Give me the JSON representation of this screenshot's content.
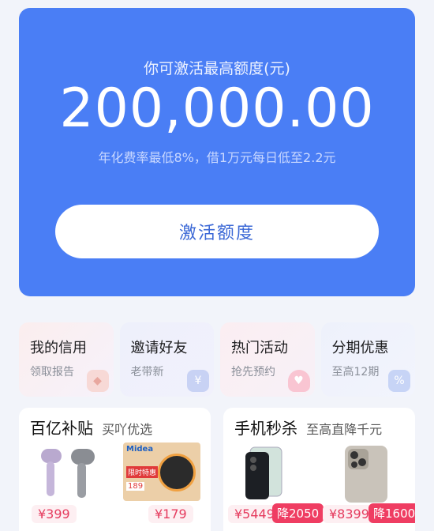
{
  "hero": {
    "title": "你可激活最高额度(元)",
    "amount": "200,000.00",
    "subtitle": "年化费率最低8%，借1万元每日低至2.2元",
    "button_label": "激活额度"
  },
  "cards": [
    {
      "title": "我的信用",
      "subtitle": "领取报告"
    },
    {
      "title": "邀请好友",
      "subtitle": "老带新"
    },
    {
      "title": "热门活动",
      "subtitle": "抢先预约"
    },
    {
      "title": "分期优惠",
      "subtitle": "至高12期"
    }
  ],
  "card_icons": [
    "yen-icon",
    "heart-icon",
    "percent-icon"
  ],
  "promo_left": {
    "title": "百亿补贴",
    "tag": "买吖优选",
    "products": [
      {
        "price": "¥399"
      },
      {
        "price": "¥179",
        "package_text": [
          "Midea",
          "限时特惠",
          "189"
        ]
      }
    ]
  },
  "promo_right": {
    "title": "手机秒杀",
    "tag": "至高直降千元",
    "products": [
      {
        "price": "¥5449",
        "discount": "降2050"
      },
      {
        "price": "¥8399",
        "discount": "降1600"
      }
    ]
  },
  "colors": {
    "hero_bg": "#4a7ef5",
    "price_red": "#e53b5e",
    "discount_bg": "#ef3d62"
  }
}
